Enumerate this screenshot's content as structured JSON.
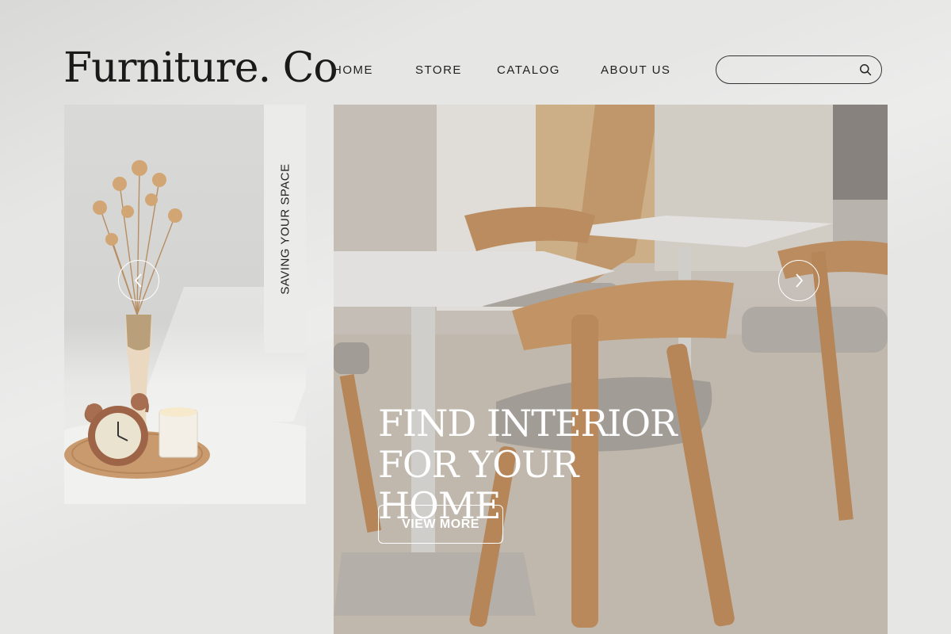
{
  "brand": {
    "logo_text": "Furniture. Co"
  },
  "nav": {
    "items": [
      {
        "label": "HOME"
      },
      {
        "label": "STORE"
      },
      {
        "label": "CATALOG"
      },
      {
        "label": "ABOUT US"
      }
    ]
  },
  "search": {
    "value": "",
    "placeholder": "",
    "icon": "search-icon"
  },
  "left_card": {
    "vertical_label": "SAVING YOUR SPACE",
    "prev_icon": "chevron-left-icon"
  },
  "hero": {
    "title": "FIND INTERIOR FOR YOUR HOME",
    "cta_label": "VIEW MORE",
    "next_icon": "chevron-right-icon"
  },
  "colors": {
    "background": "#e6e6e5",
    "text": "#1a1a1a",
    "wood": "#c99a6a",
    "overlay_text": "#ffffff"
  }
}
